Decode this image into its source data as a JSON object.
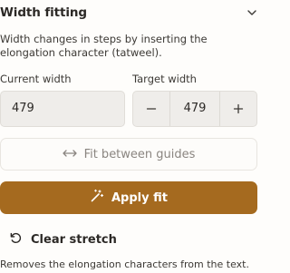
{
  "section": {
    "title": "Width fitting",
    "collapse_icon": "chevron-down-icon",
    "description": "Width changes in steps by inserting the elongation character (tatweel)."
  },
  "current_width": {
    "label": "Current width",
    "value": "479"
  },
  "target_width": {
    "label": "Target width",
    "value": "479",
    "decrement_icon": "minus-icon",
    "increment_icon": "plus-icon"
  },
  "fit_guides": {
    "label": "Fit between guides",
    "icon": "horizontal-arrows-icon",
    "disabled": true
  },
  "apply": {
    "label": "Apply fit",
    "icon": "magic-wand-icon",
    "color": "#a56a1f"
  },
  "clear": {
    "label": "Clear stretch",
    "icon": "rotate-ccw-icon",
    "note": "Removes the elongation characters from the text."
  }
}
